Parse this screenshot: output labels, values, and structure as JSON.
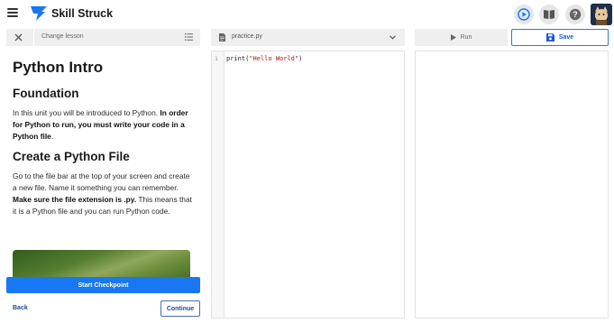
{
  "header": {
    "brand": "Skill Struck",
    "icons": [
      "menu-icon",
      "play-circle-icon",
      "book-icon",
      "help-icon"
    ],
    "accent_color": "#1877f2"
  },
  "lesson_bar": {
    "change_label": "Change lesson"
  },
  "lesson": {
    "title": "Python Intro",
    "section1_heading": "Foundation",
    "section1_text": "In this unit you will be introduced to Python.",
    "section1_bold": "In order for Python to run, you must write your code in a Python file",
    "section1_end": ".",
    "section2_heading": "Create a Python File",
    "section2_text": "Go to the file bar at the top of your screen and create a new file. Name it something you can remember.",
    "section2_bold": "Make sure the file extension is .py.",
    "section2_end": "This means that it is a Python file and you can run Python code."
  },
  "actions": {
    "start_checkpoint": "Start Checkpoint",
    "back": "Back",
    "continue": "Continue"
  },
  "editor": {
    "file_name": "practice.py",
    "line_number": "1",
    "code_fn": "print(",
    "code_str": "\"Hello World\"",
    "code_end": ")"
  },
  "run_panel": {
    "run_label": "Run",
    "save_label": "Save"
  }
}
